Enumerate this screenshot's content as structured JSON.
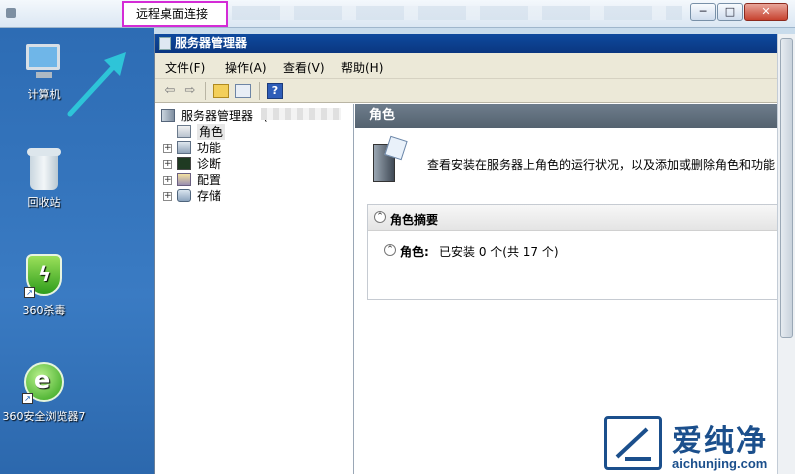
{
  "outer_window": {
    "title_label": "远程桌面连接",
    "highlight_color": "#d42bd6",
    "minimize": "─",
    "maximize": "□",
    "close": "✕"
  },
  "desktop": {
    "icons": [
      {
        "label": "计算机",
        "icon": "computer-icon"
      },
      {
        "label": "回收站",
        "icon": "recycle-bin-icon"
      },
      {
        "label": "360杀毒",
        "icon": "360-antivirus-icon"
      },
      {
        "label": "360安全浏览器7",
        "icon": "360-browser-icon"
      }
    ],
    "pointer_arrow_color": "#2ec4d8"
  },
  "server_manager": {
    "title": "服务器管理器",
    "menu": [
      "文件(F)",
      "操作(A)",
      "查看(V)",
      "帮助(H)"
    ],
    "toolbar": {
      "back": "⇦",
      "forward": "⇨",
      "help": "?"
    },
    "tree": {
      "root": "服务器管理器",
      "root_suffix": "(",
      "items": [
        "角色",
        "功能",
        "诊断",
        "配置",
        "存储"
      ]
    },
    "content": {
      "header": "角色",
      "intro": "查看安装在服务器上角色的运行状况，以及添加或删除角色和功能",
      "summary_title": "角色摘要",
      "roles_label": "角色:",
      "roles_value": "已安装 0 个(共 17 个)"
    }
  },
  "watermark": {
    "text": "爱纯净",
    "url": "aichunjing.com"
  },
  "colors": {
    "title_bar": "#0e4a9e",
    "content_header": "#5f6e7d",
    "desktop": "#2f6fb6"
  }
}
